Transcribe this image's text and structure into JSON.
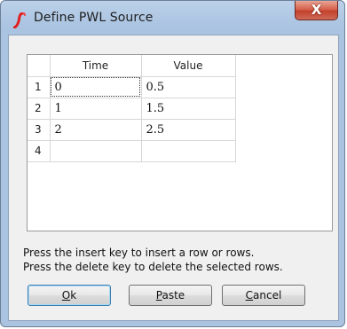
{
  "window": {
    "title": "Define PWL Source",
    "close_label": "X"
  },
  "table": {
    "headers": [
      "Time",
      "Value"
    ],
    "rows": [
      {
        "num": "1",
        "time": "0",
        "value": "0.5"
      },
      {
        "num": "2",
        "time": "1",
        "value": "1.5"
      },
      {
        "num": "3",
        "time": "2",
        "value": "2.5"
      },
      {
        "num": "4",
        "time": "",
        "value": ""
      }
    ]
  },
  "help": {
    "line1": "Press the insert key to insert a row or rows.",
    "line2": "Press the delete key to delete the selected rows."
  },
  "buttons": {
    "ok": {
      "accel": "O",
      "rest": "k"
    },
    "paste": {
      "accel": "P",
      "rest": "aste"
    },
    "cancel": {
      "accel": "C",
      "rest": "ancel"
    }
  },
  "colors": {
    "frame": "#a9c3e1",
    "close": "#c3412b",
    "icon": "#e02020"
  }
}
